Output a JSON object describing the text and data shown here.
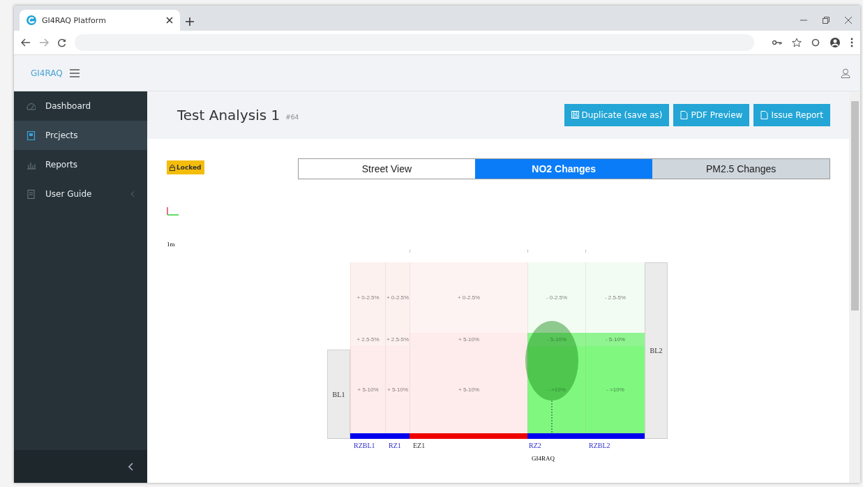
{
  "browser": {
    "tab_title": "GI4RAQ Platform"
  },
  "app": {
    "brand": "GI4RAQ"
  },
  "sidebar": {
    "items": [
      {
        "label": "Dashboard",
        "selected": false,
        "has_submenu": false
      },
      {
        "label": "Prcjects",
        "selected": true,
        "has_submenu": false
      },
      {
        "label": "Reports",
        "selected": false,
        "has_submenu": false
      },
      {
        "label": "User Guide",
        "selected": false,
        "has_submenu": true
      }
    ]
  },
  "page": {
    "title": "Test Analysis 1",
    "id": "#64",
    "status": "Locked",
    "actions": [
      "Duplicate (save as)",
      "PDF Preview",
      "Issue Report"
    ]
  },
  "view_tabs": [
    {
      "label": "Street View",
      "selected": false
    },
    {
      "label": "NO2 Changes",
      "selected": true
    },
    {
      "label": "PM2.5 Changes",
      "selected": false
    }
  ],
  "diagram": {
    "scale": "1m",
    "buildings": [
      "BL1",
      "BL2"
    ],
    "marker_label": "GI4RAQ",
    "zones": [
      {
        "label": "RZBL1",
        "kind": "recipient",
        "color": "#0000ee",
        "cells": [
          {
            "text": "+ 0-2.5%",
            "color": "#fdf1f0"
          },
          {
            "text": "+ 2.5-5%",
            "color": "#fdf1f0"
          },
          {
            "text": "+ 5-10%",
            "color": "#fdeceb"
          }
        ]
      },
      {
        "label": "RZ1",
        "kind": "recipient",
        "color": "#0000ee",
        "cells": [
          {
            "text": "+ 0-2.5%",
            "color": "#fdf1f0"
          },
          {
            "text": "+ 2.5-5%",
            "color": "#fdf1f0"
          },
          {
            "text": "+ 5-10%",
            "color": "#fdeceb"
          }
        ]
      },
      {
        "label": "EZ1",
        "kind": "emitter",
        "color": "#ee0000",
        "cells": [
          {
            "text": "+ 0-2.5%",
            "color": "#fdf3f2"
          },
          {
            "text": "+ 5-10%",
            "color": "#fdeceb"
          },
          {
            "text": "+ 5-10%",
            "color": "#fdeceb"
          }
        ]
      },
      {
        "label": "RZ2",
        "kind": "recipient",
        "color": "#0000ee",
        "cells": [
          {
            "text": "- 0-2.5%",
            "color": "#f3fcf2"
          },
          {
            "text": "- 5-10%",
            "color": "#90f590"
          },
          {
            "text": "- >10%",
            "color": "#80f880"
          }
        ]
      },
      {
        "label": "RZBL2",
        "kind": "recipient",
        "color": "#0000ee",
        "cells": [
          {
            "text": "- 2.5-5%",
            "color": "#f3fcf2"
          },
          {
            "text": "- 5-10%",
            "color": "#90f590"
          },
          {
            "text": "- >10%",
            "color": "#80f880"
          }
        ]
      }
    ]
  }
}
